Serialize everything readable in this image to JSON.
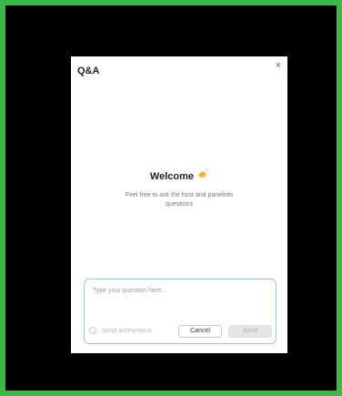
{
  "dialog": {
    "title": "Q&A",
    "close_symbol": "×"
  },
  "welcome": {
    "title": "Welcome",
    "icon": "waving-hand-icon",
    "subtitle": "Feel free to ask the host and panelists questions"
  },
  "question_input": {
    "placeholder": "Type your question here...",
    "value": ""
  },
  "anonymous": {
    "label": "Send anonymous",
    "checked": false
  },
  "buttons": {
    "cancel_label": "Cancel",
    "send_label": "Send"
  },
  "colors": {
    "border_outer": "#3fb54a",
    "input_border": "#9ec3ea",
    "send_disabled_bg": "#e6e6e6"
  }
}
